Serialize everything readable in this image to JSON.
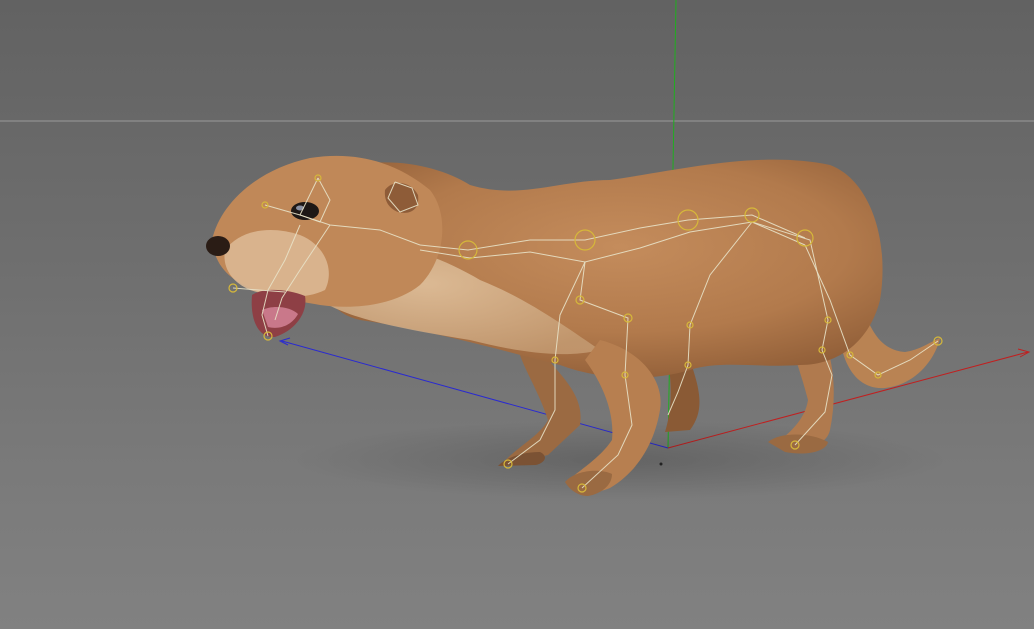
{
  "viewport": {
    "background_top": "#626262",
    "background_bottom": "#818181",
    "horizon_line_color": "#9a9a9a"
  },
  "axes": {
    "x_axis_color": "#c02020",
    "y_axis_color": "#1fae1f",
    "z_axis_color": "#2a2ad0"
  },
  "model": {
    "object": "otter",
    "fur_color": "#b97f52",
    "fur_light_color": "#d8b48e",
    "skeleton_bone_color": "#e8e2c8",
    "skeleton_joint_color": "#d6b83a"
  }
}
